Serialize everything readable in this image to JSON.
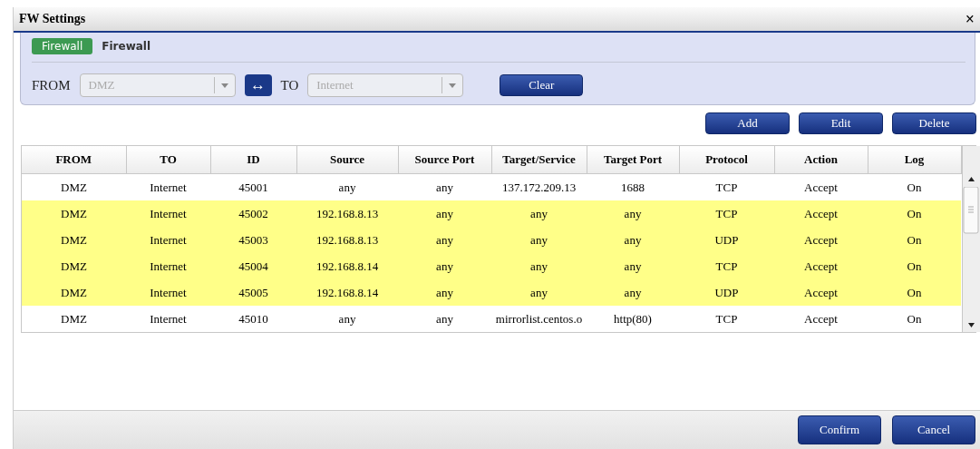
{
  "window": {
    "title": "FW Settings",
    "close": "×"
  },
  "filter": {
    "badge": "Firewall",
    "heading": "Firewall",
    "from_label": "FROM",
    "from_value": "DMZ",
    "swap": "↔",
    "to_label": "TO",
    "to_value": "Internet",
    "clear": "Clear"
  },
  "actions": [
    "Add",
    "Edit",
    "Delete"
  ],
  "table": {
    "columns": [
      "FROM",
      "TO",
      "ID",
      "Source",
      "Source Port",
      "Target/Service",
      "Target Port",
      "Protocol",
      "Action",
      "Log"
    ],
    "rows": [
      {
        "highlighted": false,
        "cells": [
          "DMZ",
          "Internet",
          "45001",
          "any",
          "any",
          "137.172.209.13",
          "1688",
          "TCP",
          "Accept",
          "On"
        ]
      },
      {
        "highlighted": true,
        "cells": [
          "DMZ",
          "Internet",
          "45002",
          "192.168.8.13",
          "any",
          "any",
          "any",
          "TCP",
          "Accept",
          "On"
        ]
      },
      {
        "highlighted": true,
        "cells": [
          "DMZ",
          "Internet",
          "45003",
          "192.168.8.13",
          "any",
          "any",
          "any",
          "UDP",
          "Accept",
          "On"
        ]
      },
      {
        "highlighted": true,
        "cells": [
          "DMZ",
          "Internet",
          "45004",
          "192.168.8.14",
          "any",
          "any",
          "any",
          "TCP",
          "Accept",
          "On"
        ]
      },
      {
        "highlighted": true,
        "cells": [
          "DMZ",
          "Internet",
          "45005",
          "192.168.8.14",
          "any",
          "any",
          "any",
          "UDP",
          "Accept",
          "On"
        ]
      },
      {
        "highlighted": false,
        "cells": [
          "DMZ",
          "Internet",
          "45010",
          "any",
          "any",
          "mirrorlist.centos.o",
          "http(80)",
          "TCP",
          "Accept",
          "On"
        ]
      }
    ]
  },
  "footer": [
    "Confirm",
    "Cancel"
  ]
}
